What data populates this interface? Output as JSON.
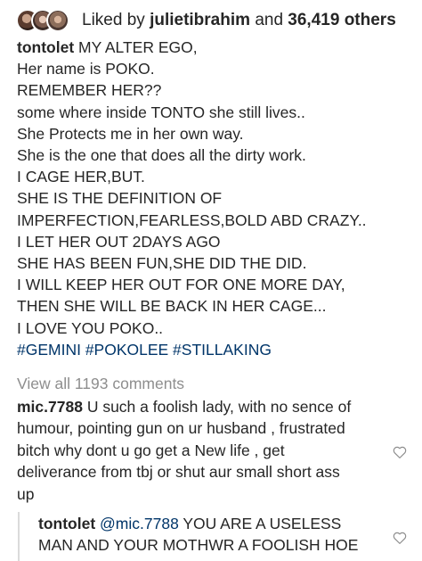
{
  "likes": {
    "prefix": "Liked by",
    "user": "julietibrahim",
    "connector": "and",
    "count": "36,419 others"
  },
  "caption": {
    "username": "tontolet",
    "first_line": "MY ALTER EGO,",
    "lines": [
      "Her name is POKO.",
      "REMEMBER HER??",
      "some where inside TONTO she still lives..",
      "She Protects me in her own way.",
      "She is the one that does all the dirty work.",
      "I CAGE HER,BUT.",
      "SHE IS THE DEFINITION OF",
      "IMPERFECTION,FEARLESS,BOLD ABD CRAZY..",
      "I LET HER OUT 2DAYS AGO",
      "SHE HAS BEEN FUN,SHE DID THE DID.",
      "I WILL KEEP HER OUT FOR ONE MORE DAY,",
      "THEN SHE WILL BE BACK IN HER CAGE...",
      "I LOVE YOU POKO.."
    ],
    "hashtags": "#GEMINI #POKOLEE #STILLAKING"
  },
  "view_all": "View all 1193 comments",
  "comment": {
    "username": "mic.7788",
    "first_line": "U such a foolish lady, with no sence of",
    "lines": [
      "humour, pointing gun on ur husband , frustrated",
      "bitch  why dont u go get a New life , get",
      "deliverance from tbj or shut aur small short ass",
      "up"
    ]
  },
  "reply": {
    "username": "tontolet",
    "mention": "@mic.7788",
    "first_line": "YOU ARE A USELESS",
    "lines": [
      "MAN AND YOUR MOTHWR A FOOLISH HOE"
    ]
  },
  "icons": {
    "like_comment": "heart-outline-icon",
    "like_reply": "heart-outline-icon"
  }
}
